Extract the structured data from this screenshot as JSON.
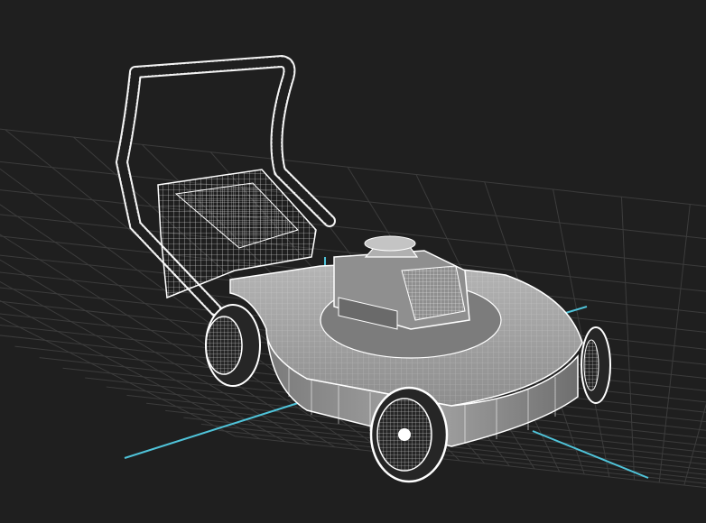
{
  "scene": {
    "subject": "lawn-mower-wireframe-model",
    "background_color": "#1f1f1f",
    "grid_color": "#3c3c3c",
    "axis_color": "#4fc3d9",
    "wire_color": "#ffffff",
    "shaded_color": "#9c9c9c"
  }
}
